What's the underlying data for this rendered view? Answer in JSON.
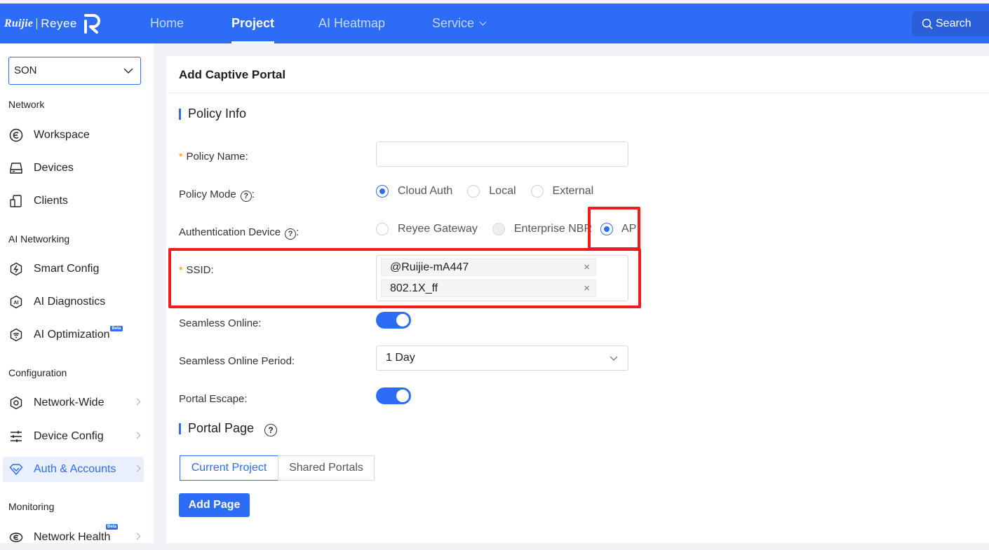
{
  "brand": {
    "name": "Ruijie",
    "product": "Reyee"
  },
  "nav": {
    "items": [
      {
        "label": "Home",
        "active": false
      },
      {
        "label": "Project",
        "active": true
      },
      {
        "label": "AI Heatmap",
        "active": false
      },
      {
        "label": "Service",
        "active": false
      }
    ],
    "search_placeholder": "Search"
  },
  "sidebar": {
    "project_selected": "SON",
    "sections": [
      {
        "title": "Network",
        "items": [
          {
            "label": "Workspace",
            "icon": "workspace-icon"
          },
          {
            "label": "Devices",
            "icon": "devices-icon"
          },
          {
            "label": "Clients",
            "icon": "clients-icon"
          }
        ]
      },
      {
        "title": "AI Networking",
        "items": [
          {
            "label": "Smart Config",
            "icon": "smart-config-icon"
          },
          {
            "label": "AI Diagnostics",
            "icon": "ai-diagnostics-icon"
          },
          {
            "label": "AI Optimization",
            "icon": "ai-optimization-icon",
            "badge": "Beta"
          }
        ]
      },
      {
        "title": "Configuration",
        "items": [
          {
            "label": "Network-Wide",
            "icon": "network-wide-icon"
          },
          {
            "label": "Device Config",
            "icon": "device-config-icon"
          },
          {
            "label": "Auth & Accounts",
            "icon": "auth-accounts-icon",
            "active": true
          }
        ]
      },
      {
        "title": "Monitoring",
        "items": [
          {
            "label": "Network Health",
            "icon": "network-health-icon",
            "badge": "Beta"
          }
        ]
      }
    ]
  },
  "page": {
    "title": "Add Captive Portal",
    "policy_info": {
      "section_title": "Policy Info",
      "policy_name": {
        "label": "Policy Name",
        "value": "",
        "required": true
      },
      "policy_mode": {
        "label": "Policy Mode",
        "options": [
          "Cloud Auth",
          "Local",
          "External"
        ],
        "selected": "Cloud Auth"
      },
      "auth_device": {
        "label": "Authentication Device",
        "options": [
          "Reyee Gateway",
          "Enterprise NBR",
          "AP"
        ],
        "selected": "AP"
      },
      "ssid": {
        "label": "SSID",
        "required": true,
        "tags": [
          "@Ruijie-mA447",
          "802.1X_ff"
        ]
      },
      "seamless_online": {
        "label": "Seamless Online",
        "enabled": true
      },
      "seamless_period": {
        "label": "Seamless Online Period",
        "value": "1 Day"
      },
      "portal_escape": {
        "label": "Portal Escape",
        "enabled": true
      }
    },
    "portal_page": {
      "section_title": "Portal Page",
      "tabs": [
        "Current Project",
        "Shared Portals"
      ],
      "active_tab": "Current Project",
      "add_button": "Add Page"
    }
  },
  "colors": {
    "primary": "#2c6cf6",
    "highlight": "#f21c1c",
    "required": "#ff8a00"
  }
}
